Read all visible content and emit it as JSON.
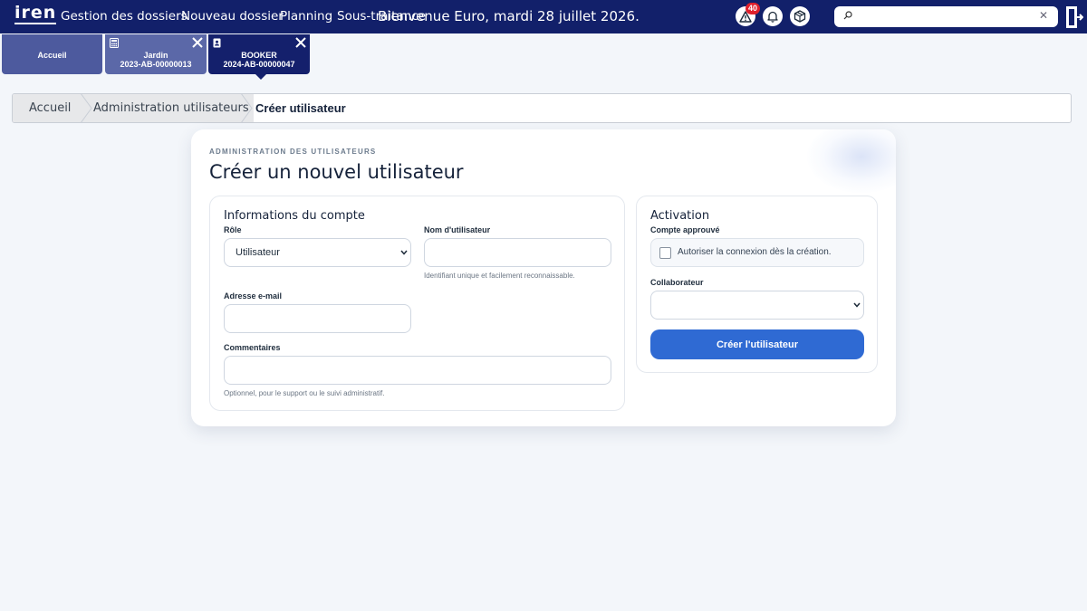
{
  "topbar": {
    "logo": "iren",
    "nav": [
      "Gestion des dossiers",
      "Nouveau dossier",
      "Planning",
      "Sous-traitance"
    ],
    "welcome": "Bienvenue Euro, mardi 28 juillet 2026.",
    "alerts_count": "40",
    "search": {
      "value": "",
      "placeholder": ""
    },
    "icons": [
      "warning-icon",
      "bell-icon",
      "package-icon",
      "search-icon",
      "close-icon",
      "logout-icon"
    ]
  },
  "tabs": [
    {
      "line1": "Accueil",
      "line2": ""
    },
    {
      "line1": "Jardin",
      "line2": "2023-AB-00000013",
      "icon": "calculator-icon"
    },
    {
      "line1": "BOOKER",
      "line2": "2024-AB-00000047",
      "icon": "id-badge-icon"
    }
  ],
  "breadcrumb": [
    "Accueil",
    "Administration utilisateurs",
    "Créer utilisateur"
  ],
  "page": {
    "eyebrow": "ADMINISTRATION DES UTILISATEURS",
    "title": "Créer un nouvel utilisateur"
  },
  "account": {
    "title": "Informations du compte",
    "role_label": "Rôle",
    "role_value": "Utilisateur",
    "username_label": "Nom d'utilisateur",
    "username_value": "",
    "username_help": "Identifiant unique et facilement reconnaissable.",
    "email_label": "Adresse e-mail",
    "email_value": "",
    "comments_label": "Commentaires",
    "comments_value": "",
    "comments_help": "Optionnel, pour le support ou le suivi administratif."
  },
  "activation": {
    "title": "Activation",
    "approved_label": "Compte approuvé",
    "approved_checkbox_label": "Autoriser la connexion dès la création.",
    "approved_checked": false,
    "collaborator_label": "Collaborateur",
    "collaborator_value": "",
    "submit_label": "Créer l'utilisateur"
  },
  "colors": {
    "topbar": "#12206a",
    "accent": "#2f6ad3",
    "badge": "#e0202c",
    "background": "#f3f6fa"
  }
}
